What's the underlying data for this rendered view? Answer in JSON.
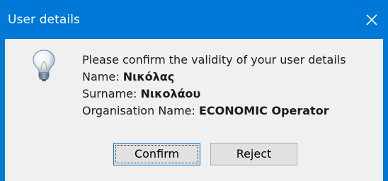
{
  "window": {
    "title": "User details",
    "close_label": "×"
  },
  "dialog": {
    "icon": "lightbulb-icon",
    "message": "Please confirm the validity of your user details",
    "name_label": "Name:",
    "name_value": "Νικόλας",
    "surname_label": "Surname:",
    "surname_value": "Νικολάου",
    "organisation_label": "Organisation Name:",
    "organisation_value": "ECONOMIC Operator"
  },
  "buttons": {
    "confirm_label": "Confirm",
    "reject_label": "Reject"
  },
  "colors": {
    "title_bar": "#0078d7",
    "dialog_background": "#f0f0f0"
  }
}
